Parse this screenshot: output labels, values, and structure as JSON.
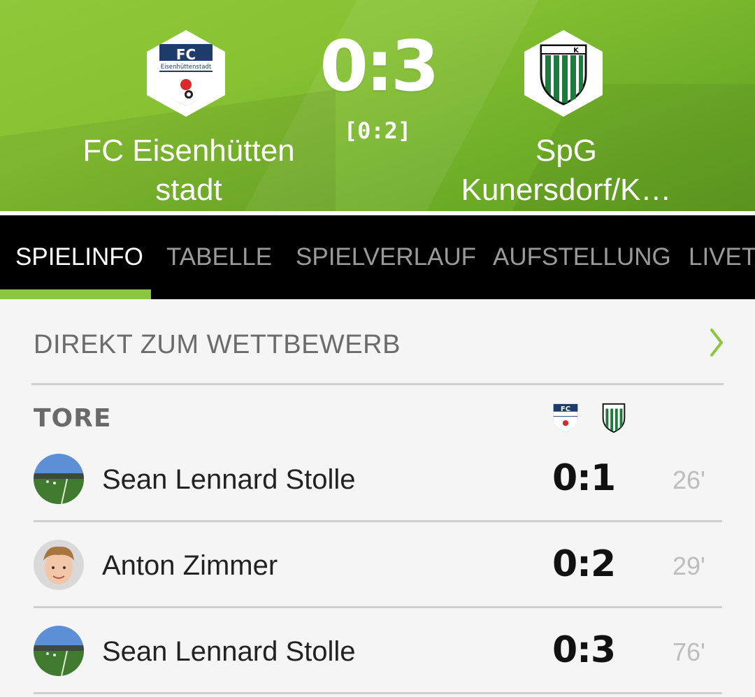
{
  "match": {
    "home_team": "FC Eisenhütten\nstadt",
    "away_team": "SpG\nKunersdorf/K…",
    "score": "0:3",
    "halftime": "[0:2]",
    "home_crest_text": "FC",
    "home_crest_sub": "Eisenhüttenstadt",
    "away_crest_text": "K"
  },
  "tabs": [
    {
      "label": "SPIELINFO",
      "active": true
    },
    {
      "label": "TABELLE",
      "active": false
    },
    {
      "label": "SPIELVERLAUF",
      "active": false
    },
    {
      "label": "AUFSTELLUNG",
      "active": false
    },
    {
      "label": "LIVET",
      "active": false
    }
  ],
  "competition_link": {
    "label": "DIREKT ZUM WETTBEWERB",
    "icon": "chevron-right-icon"
  },
  "goals_section": {
    "title": "TORE",
    "goals": [
      {
        "player": "Sean Lennard Stolle",
        "score": "0:1",
        "minute": "26'"
      },
      {
        "player": "Anton Zimmer",
        "score": "0:2",
        "minute": "29'"
      },
      {
        "player": "Sean Lennard Stolle",
        "score": "0:3",
        "minute": "76'"
      }
    ]
  },
  "colors": {
    "accent": "#8cc63f",
    "header_green": "#7bbb2e",
    "tab_bg": "#000000",
    "away_stripe": "#1e7a3c",
    "home_navy": "#1d3b6b"
  }
}
